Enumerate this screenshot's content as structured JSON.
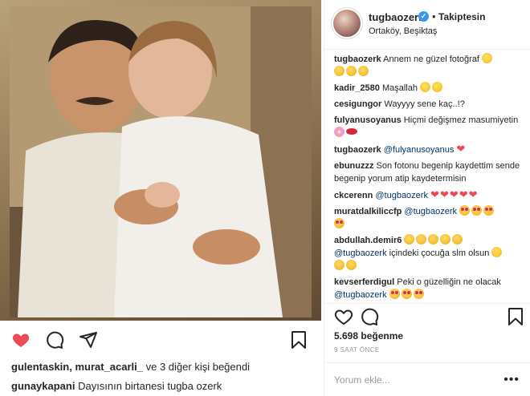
{
  "post": {
    "image_alt": "photo",
    "liked_by": "gulentaskin, murat_acarli_",
    "liked_by_suffix": " ve 3 diğer kişi beğendi",
    "caption_user": "gunaykapani",
    "caption_text": " Dayısının birtanesi tugba ozerk"
  },
  "header": {
    "username": "tugbaozerk",
    "verified_mark": "✓",
    "dot": "•",
    "follow_state": "Takiptesin",
    "location": "Ortaköy, Beşiktaş"
  },
  "comments": [
    {
      "user": "tugbaozerk",
      "text": " Annem ne güzel fotoğraf "
    },
    {
      "user": "kadir_2580",
      "text": " Maşallah "
    },
    {
      "user": "cesigungor",
      "text": " Wayyyy sene kaç..!?"
    },
    {
      "user": "fulyanusoyanus",
      "text": " Hiçmi değişmez masumiyetin "
    },
    {
      "user": "tugbaozerk",
      "mention": " @fulyanusoyanus",
      "text": " "
    },
    {
      "user": "ebunuzzz",
      "text": " Son fotonu begenip kaydettim sende begenip yorum atip kaydetermisin"
    },
    {
      "user": "ckcerenn",
      "mention": " @tugbaozerk",
      "text": " "
    },
    {
      "user": "muratdalkiliccfp",
      "mention": " @tugbaozerk",
      "text": " "
    },
    {
      "user": "abdullah.demir6",
      "mention_after": "@tugbaozerk",
      "text_after": " içindeki çocuğa slm olsun "
    },
    {
      "user": "kevserferdigul",
      "text": " Peki o güzelliğin ne olacak ",
      "mention_after": "@tugbaozerk"
    }
  ],
  "stats": {
    "likes_count": "5.698",
    "likes_label": " beğenme",
    "time_ago": "9 SAAT ÖNCE"
  },
  "comment_box": {
    "placeholder": "Yorum ekle...",
    "more": "•••"
  },
  "colors": {
    "like_red": "#ed4956",
    "verified_blue": "#3897f0",
    "mention_blue": "#003569",
    "border": "#efefef"
  },
  "icons": [
    "heart-icon",
    "comment-icon",
    "share-icon",
    "bookmark-icon",
    "verified-icon",
    "heart-outline-icon",
    "more-icon"
  ]
}
